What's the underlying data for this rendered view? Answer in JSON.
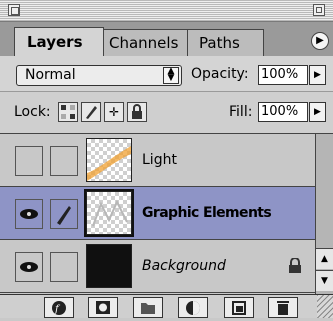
{
  "tabs": [
    {
      "label": "Layers"
    },
    {
      "label": "Channels"
    },
    {
      "label": "Paths"
    }
  ],
  "blend": {
    "mode": "Normal"
  },
  "opacity": {
    "label": "Opacity:",
    "value": "100%"
  },
  "lock": {
    "label": "Lock:"
  },
  "fill": {
    "label": "Fill:",
    "value": "100%"
  },
  "layers": [
    {
      "name": "Light",
      "visible": false,
      "selected": false
    },
    {
      "name": "Graphic Elements",
      "visible": true,
      "selected": true
    },
    {
      "name": "Background",
      "visible": true,
      "selected": false,
      "locked": true
    }
  ],
  "colors": {
    "selection": "#8e94c6",
    "panel": "#d4d4d4",
    "tab_bar": "#9a9a9a"
  },
  "icons": [
    "palette-menu-icon",
    "layer-style-icon",
    "layer-mask-icon",
    "new-set-icon",
    "adjustment-layer-icon",
    "new-layer-icon",
    "trash-icon",
    "eye-icon",
    "brush-icon",
    "lock-icon"
  ]
}
